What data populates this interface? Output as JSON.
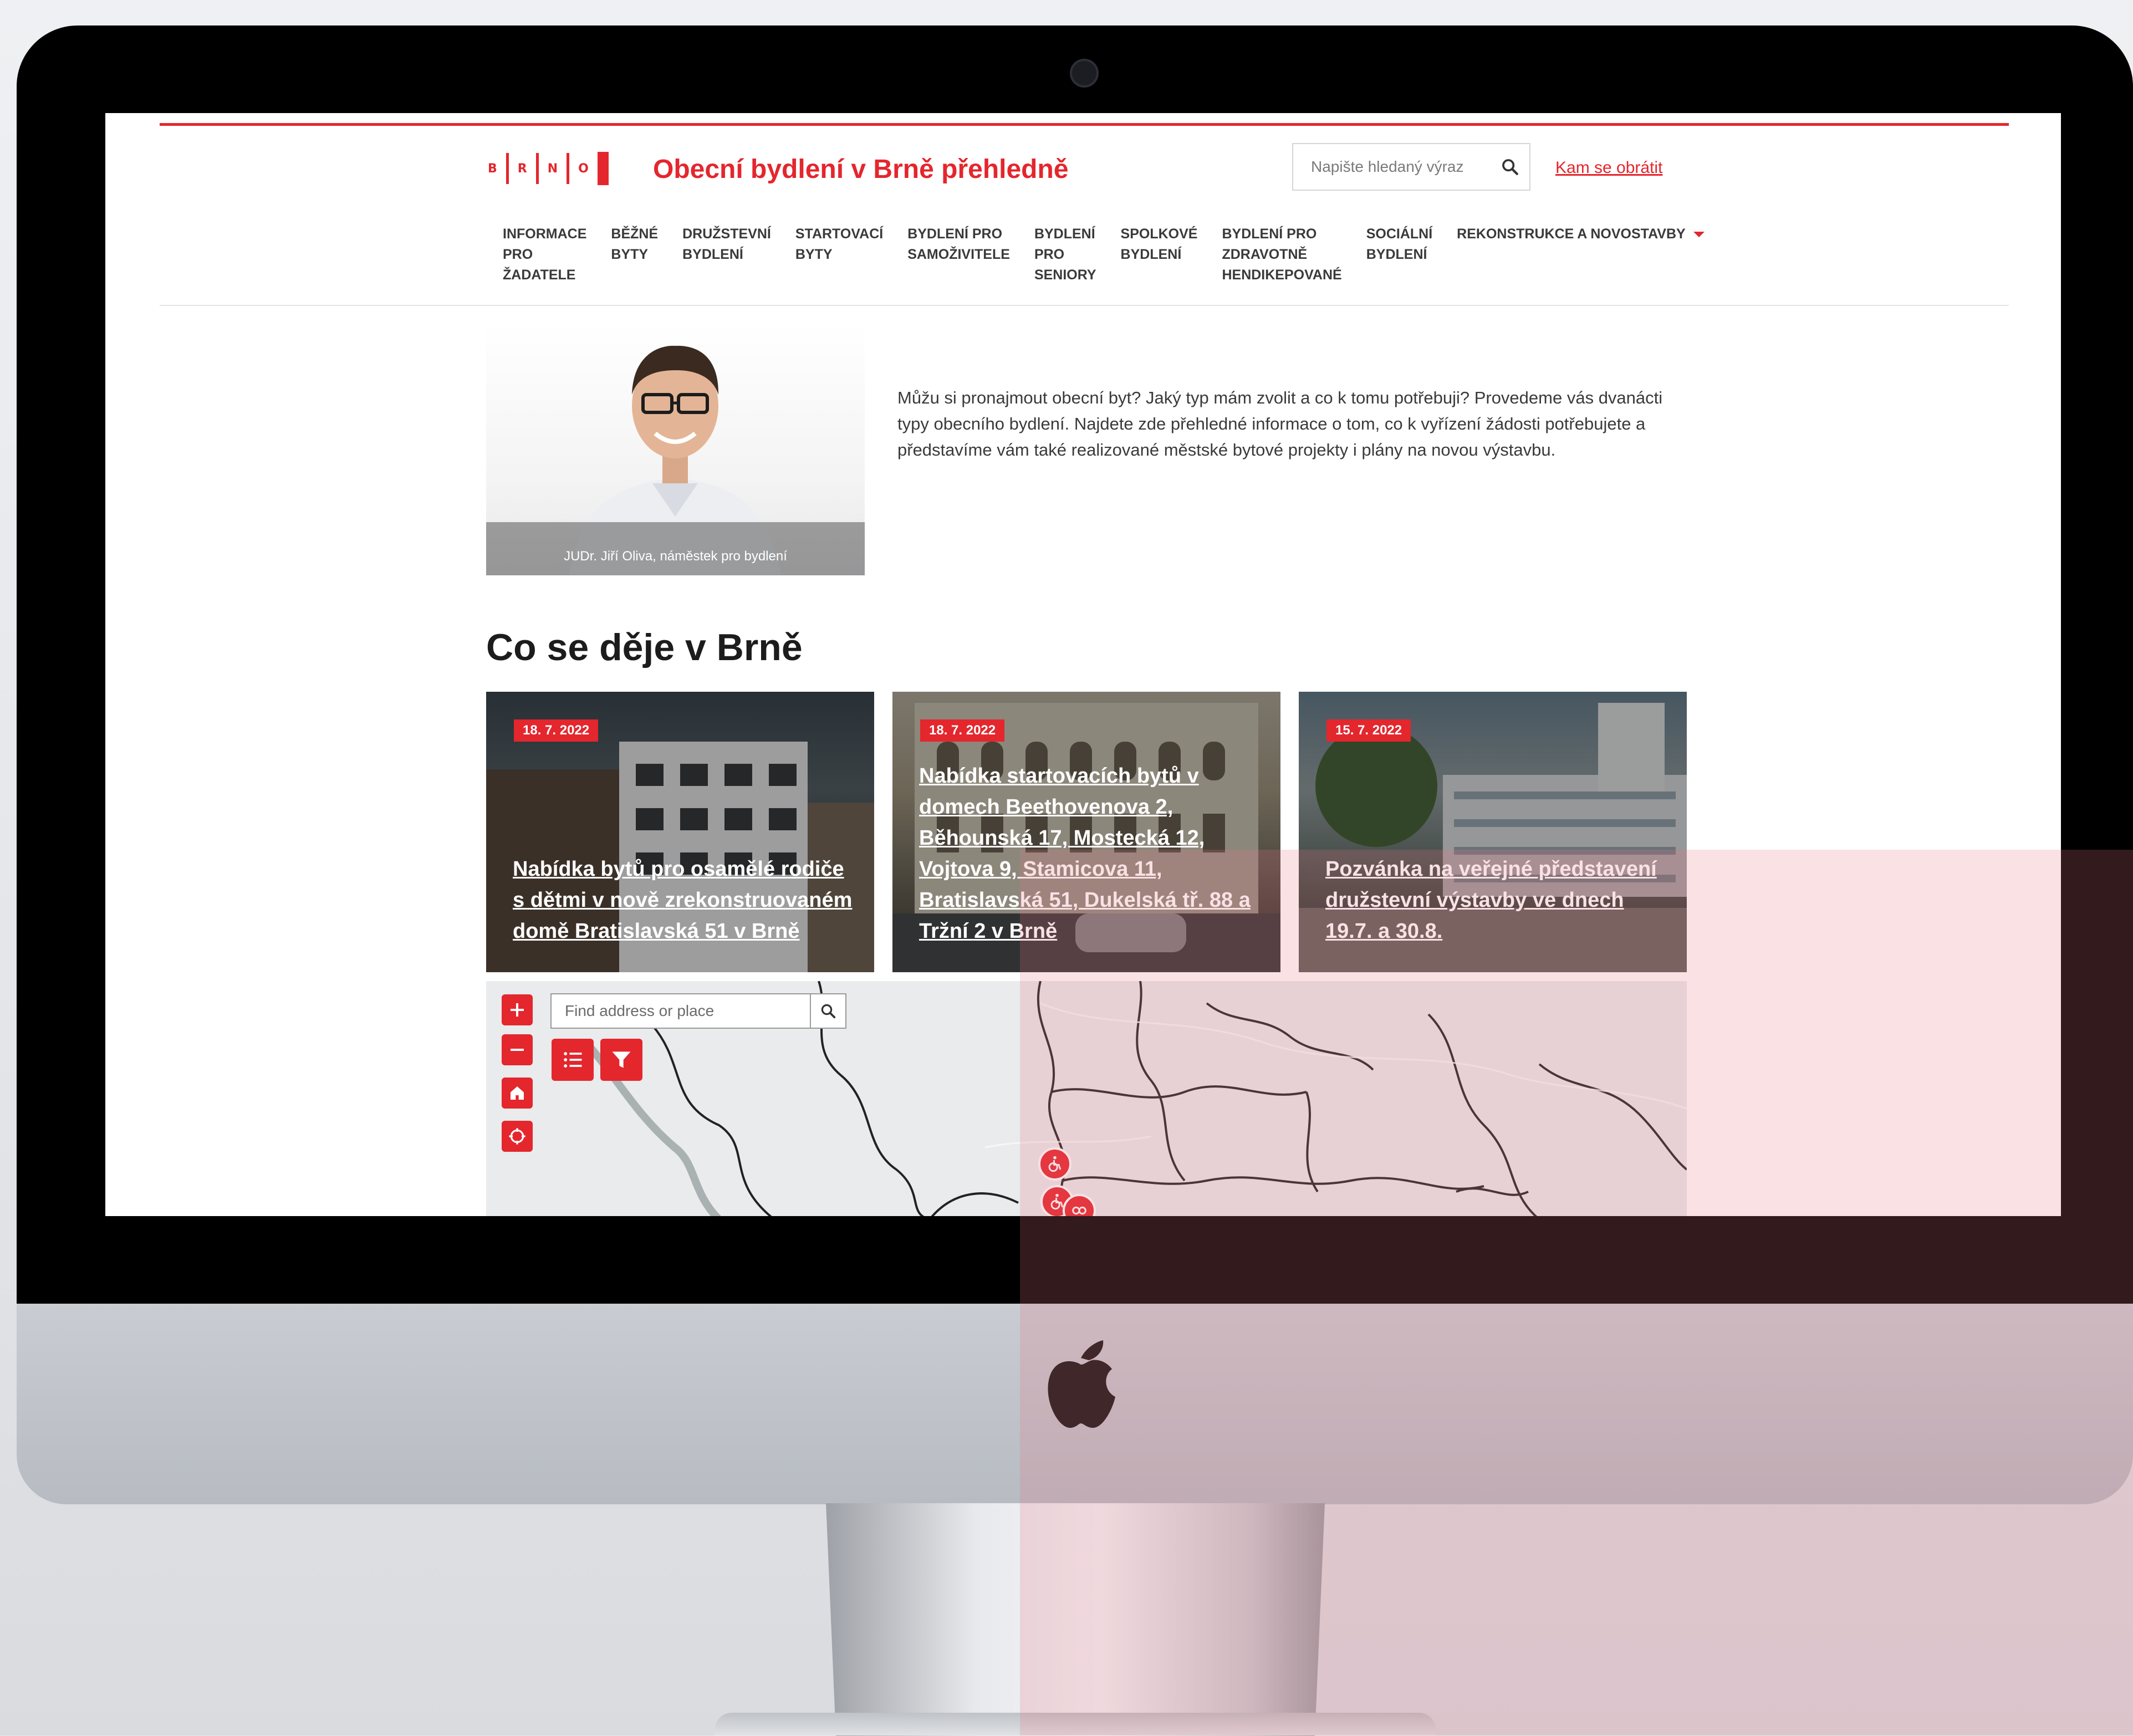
{
  "colors": {
    "brand_red": "#e4262d",
    "screen_bg": "#ffffff",
    "device_black": "#000000"
  },
  "header": {
    "logo_letters": [
      "B",
      "R",
      "N",
      "O"
    ],
    "site_title": "Obecní bydlení v Brně přehledně",
    "search_placeholder": "Napište hledaný výraz",
    "contact_link": "Kam se obrátit"
  },
  "nav": {
    "items": [
      {
        "lines": [
          "INFORMACE",
          "PRO",
          "ŽADATELE"
        ]
      },
      {
        "lines": [
          "BĚŽNÉ",
          "BYTY"
        ]
      },
      {
        "lines": [
          "DRUŽSTEVNÍ",
          "BYDLENÍ"
        ]
      },
      {
        "lines": [
          "STARTOVACÍ",
          "BYTY"
        ]
      },
      {
        "lines": [
          "BYDLENÍ PRO",
          "SAMOŽIVITELE"
        ]
      },
      {
        "lines": [
          "BYDLENÍ",
          "PRO",
          "SENIORY"
        ]
      },
      {
        "lines": [
          "SPOLKOVÉ",
          "BYDLENÍ"
        ]
      },
      {
        "lines": [
          "BYDLENÍ PRO",
          "ZDRAVOTNĚ",
          "HENDIKEPOVANÉ"
        ]
      },
      {
        "lines": [
          "SOCIÁLNÍ",
          "BYDLENÍ"
        ]
      },
      {
        "lines": [
          "REKONSTRUKCE A NOVOSTAVBY"
        ]
      }
    ]
  },
  "intro": {
    "photo_caption": "JUDr. Jiří Oliva, náměstek pro bydlení",
    "text": "Můžu si pronajmout obecní byt? Jaký typ mám zvolit a co k tomu potřebuji? Provedeme vás dvanácti typy obecního bydlení. Najdete zde přehledné informace o tom, co k vyřízení žádosti potřebujete a představíme vám také realizované městské bytové projekty i plány na novou výstavbu."
  },
  "news": {
    "section_title": "Co se děje v Brně",
    "cards": [
      {
        "date": "18. 7. 2022",
        "title": "Nabídka bytů pro osamělé rodiče s dětmi v nově zrekonstruovaném domě Bratislavská 51 v Brně"
      },
      {
        "date": "18. 7. 2022",
        "title": "Nabídka startovacích bytů v domech Beethovenova 2, Běhounská 17, Mostecká 12, Vojtova 9, Stamicova 11, Bratislavská 51, Dukelská tř. 88 a Tržní 2 v Brně"
      },
      {
        "date": "15. 7. 2022",
        "title": "Pozvánka na veřejné představení družstevní výstavby ve dnech 19.7. a 30.8."
      }
    ]
  },
  "map": {
    "search_placeholder": "Find address or place",
    "controls": [
      "zoom-in-icon",
      "zoom-out-icon",
      "home-icon",
      "locate-icon"
    ],
    "tools": [
      "list-icon",
      "filter-icon"
    ],
    "markers": [
      "wheelchair-icon",
      "wheelchair-icon",
      "cluster-icon"
    ]
  }
}
